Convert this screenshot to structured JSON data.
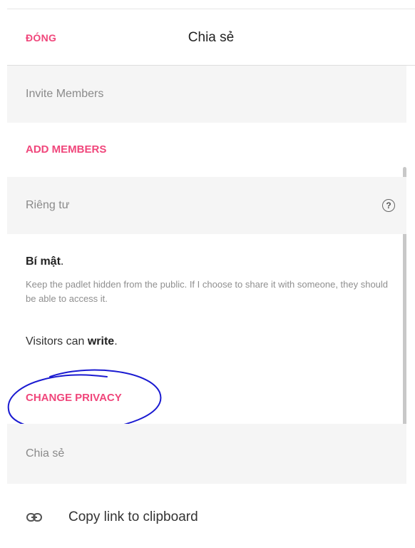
{
  "header": {
    "close_label": "ĐÓNG",
    "title": "Chia sẻ"
  },
  "invite": {
    "heading": "Invite Members",
    "add_members_label": "ADD MEMBERS"
  },
  "privacy": {
    "heading": "Riêng tư",
    "help_icon": "?",
    "mode_title": "Bí mật",
    "mode_title_suffix": ".",
    "description": "Keep the padlet hidden from the public. If I choose to share it with someone, they should be able to access it.",
    "visitors_prefix": "Visitors can ",
    "visitors_permission": "write",
    "visitors_suffix": ".",
    "change_label": "CHANGE PRIVACY"
  },
  "share": {
    "heading": "Chia sẻ",
    "copy_link_label": "Copy link to clipboard",
    "copy_link_icon": "link-icon"
  },
  "colors": {
    "accent": "#f0467b",
    "scribble": "#1a1ad1"
  }
}
